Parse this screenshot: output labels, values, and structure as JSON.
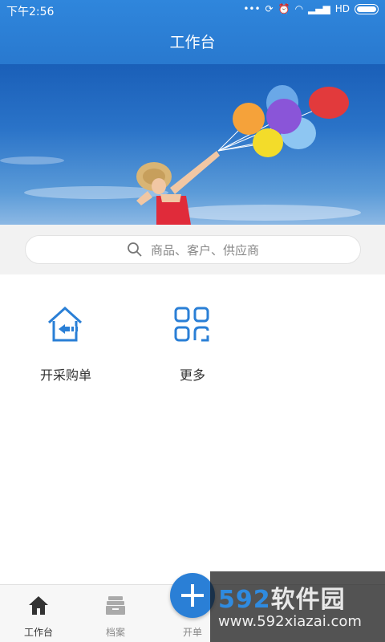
{
  "status_bar": {
    "time": "下午2:56",
    "network": "HD"
  },
  "header": {
    "title": "工作台"
  },
  "search": {
    "placeholder": "商品、客户、供应商",
    "icon": "search-icon"
  },
  "grid": [
    {
      "label": "开采购单",
      "icon": "purchase-order-icon"
    },
    {
      "label": "更多",
      "icon": "more-grid-icon"
    }
  ],
  "tabs": [
    {
      "label": "工作台",
      "icon": "home-icon",
      "active": true
    },
    {
      "label": "档案",
      "icon": "archive-icon",
      "active": false
    },
    {
      "label": "开单",
      "icon": "add-icon",
      "active": false
    }
  ],
  "watermark": {
    "brand_num": "592",
    "brand_cn": "软件园",
    "url": "www.592xiazai.com"
  },
  "colors": {
    "primary": "#2a7fd6",
    "header": "#2f86dc",
    "text": "#333333"
  }
}
